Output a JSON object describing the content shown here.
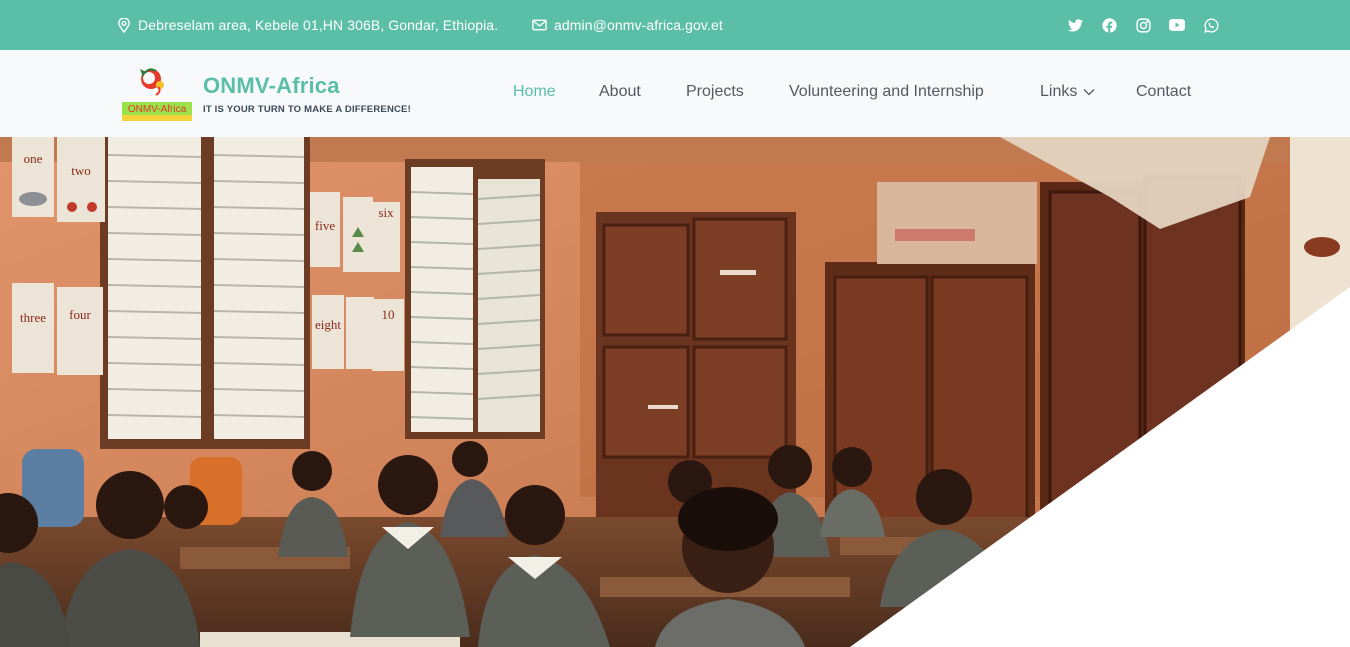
{
  "topbar": {
    "address": "Debreselam area, Kebele 01,HN 306B, Gondar, Ethiopia.",
    "email": "admin@onmv-africa.gov.et",
    "socials": [
      "twitter-icon",
      "facebook-icon",
      "instagram-icon",
      "youtube-icon",
      "whatsapp-icon"
    ]
  },
  "brand": {
    "name": "ONMV-Africa",
    "tagline": "IT IS YOUR TURN TO MAKE A DIFFERENCE!",
    "logo_text": "ONMV-Africa"
  },
  "nav": {
    "items": [
      {
        "label": "Home",
        "active": true
      },
      {
        "label": "About",
        "active": false
      },
      {
        "label": "Projects",
        "active": false
      },
      {
        "label": "Volunteering and Internship",
        "active": false
      },
      {
        "label": "Links",
        "active": false
      },
      {
        "label": "Contact",
        "active": false
      }
    ]
  },
  "hero": {
    "image": "classroom-children-photo",
    "wall_cards": [
      "one",
      "two",
      "three",
      "four",
      "five",
      "six",
      "eight",
      "10"
    ]
  },
  "colors": {
    "accent": "#5bbfa8",
    "nav_text": "#555a60",
    "header_bg": "#f7f9fb"
  }
}
